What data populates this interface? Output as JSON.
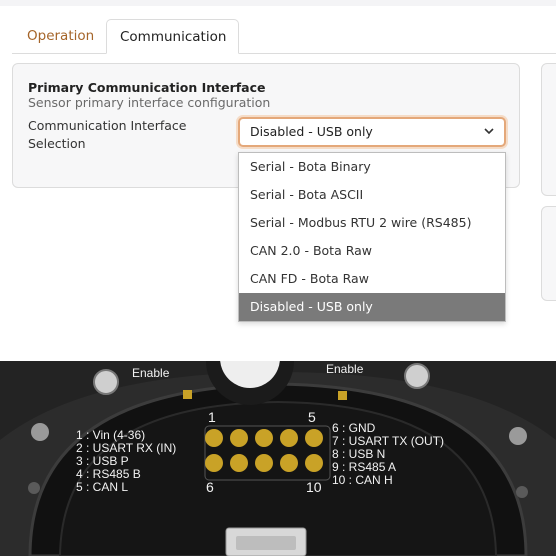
{
  "tabs": [
    {
      "label": "Operation",
      "active": false
    },
    {
      "label": "Communication",
      "active": true
    }
  ],
  "card": {
    "title": "Primary Communication Interface",
    "subtitle": "Sensor primary interface configuration",
    "field_label": "Communication Interface Selection"
  },
  "select": {
    "value": "Disabled - USB only",
    "options": [
      "Serial - Bota Binary",
      "Serial - Bota ASCII",
      "Serial - Modbus RTU 2 wire (RS485)",
      "CAN 2.0 - Bota Raw",
      "CAN FD - Bota Raw",
      "Disabled - USB only"
    ],
    "selected_index": 5
  },
  "board": {
    "left_enable": "Enable",
    "right_enable": "Enable",
    "pin_1": "1",
    "pin_5": "5",
    "pin_6": "6",
    "pin_10": "10",
    "left_pins": [
      "1 : Vin (4-36)",
      "2 : USART RX (IN)",
      "3 : USB P",
      "4 : RS485 B",
      "5 : CAN L"
    ],
    "right_pins": [
      "6 : GND",
      "7 : USART TX (OUT)",
      "8 : USB N",
      "9 : RS485 A",
      "10 : CAN H"
    ]
  },
  "colors": {
    "accent": "#a5652a",
    "focus_border": "#e4a87a",
    "selected_option_bg": "#7a7a7a",
    "pcb": "#141414",
    "gold_pad": "#c9a227"
  }
}
